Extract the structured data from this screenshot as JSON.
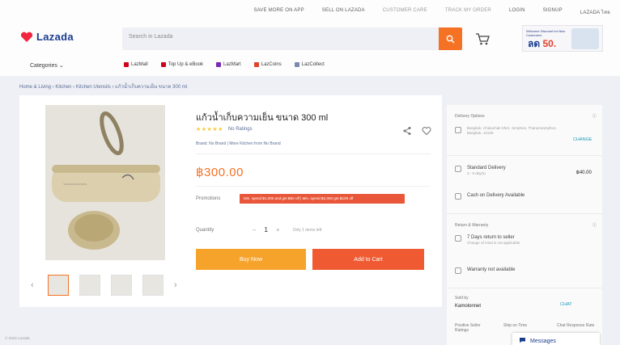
{
  "colors": {
    "brand_orange": "#f57224",
    "buy_now": "#f6a32b",
    "add_to_cart": "#f05a32",
    "lazada_blue": "#1a3c8f",
    "link_teal": "#1a9cb7"
  },
  "topbar": {
    "links": [
      "SAVE MORE ON APP",
      "SELL ON LAZADA",
      "CUSTOMER CARE",
      "TRACK MY ORDER",
      "LOGIN",
      "SIGNUP",
      "LAZADA ไทย"
    ]
  },
  "header": {
    "logo_text": "Lazada",
    "search_placeholder": "Search in Lazada",
    "promo": {
      "caption": "Welcome Discount for New Customers",
      "big_text": "ลด",
      "number": "50."
    }
  },
  "catnav": {
    "categories_label": "Categories",
    "links": [
      {
        "label": "LazMall",
        "color": "#d0011b"
      },
      {
        "label": "Top Up & eBook",
        "color": "#d0011b"
      },
      {
        "label": "LazMart",
        "color": "#7a2ab4"
      },
      {
        "label": "LazCoins",
        "color": "#e0432c"
      },
      {
        "label": "LazCollect",
        "color": "#7a8ab0"
      }
    ]
  },
  "breadcrumb": "Home & Living  ›  Kitchen  ›  Kitchen Utensils  ›  แก้วน้ำเก็บความเย็น ขนาด 300 ml",
  "product": {
    "title": "แก้วน้ำเก็บความเย็น ขนาด 300 ml",
    "ratings_text": "No Ratings",
    "brand_line": "Brand: No Brand | More Kitchen from No Brand",
    "price": "฿300.00",
    "promotions_label": "Promotions",
    "promotion_tag": "Min. spend ฿1,000 and get ฿50 off | Min. spend ฿2,000 get ฿100 off",
    "quantity_label": "Quantity",
    "quantity_minus": "–",
    "quantity_value": "1",
    "quantity_plus": "+",
    "quantity_availability": "Only 1 items left",
    "buy_now": "Buy Now",
    "add_to_cart": "Add to Cart"
  },
  "side": {
    "delivery_header": "Delivery Options",
    "location": "Bangkok, Chatuchak Khet, Jomphon, Thanonnamphon, Bangkok, 10130",
    "change_link": "CHANGE",
    "standard_delivery": "Standard Delivery",
    "standard_delivery_sub": "3 - 5 day(s)",
    "delivery_fee": "฿40.00",
    "cod": "Cash on Delivery Available",
    "service_header": "Return & Warranty",
    "returns": "7 Days return to seller",
    "returns_sub": "Change of mind is not applicable",
    "warranty": "Warranty not available",
    "sold_by_label": "Sold by",
    "seller_name": "Kamolonnet",
    "chat_link": "CHAT",
    "stats": [
      "Positive Seller Ratings",
      "Ship on Time",
      "Chat Response Rate"
    ]
  },
  "chat_widget": "Messages",
  "footer_note": "© 2023 Lazada"
}
